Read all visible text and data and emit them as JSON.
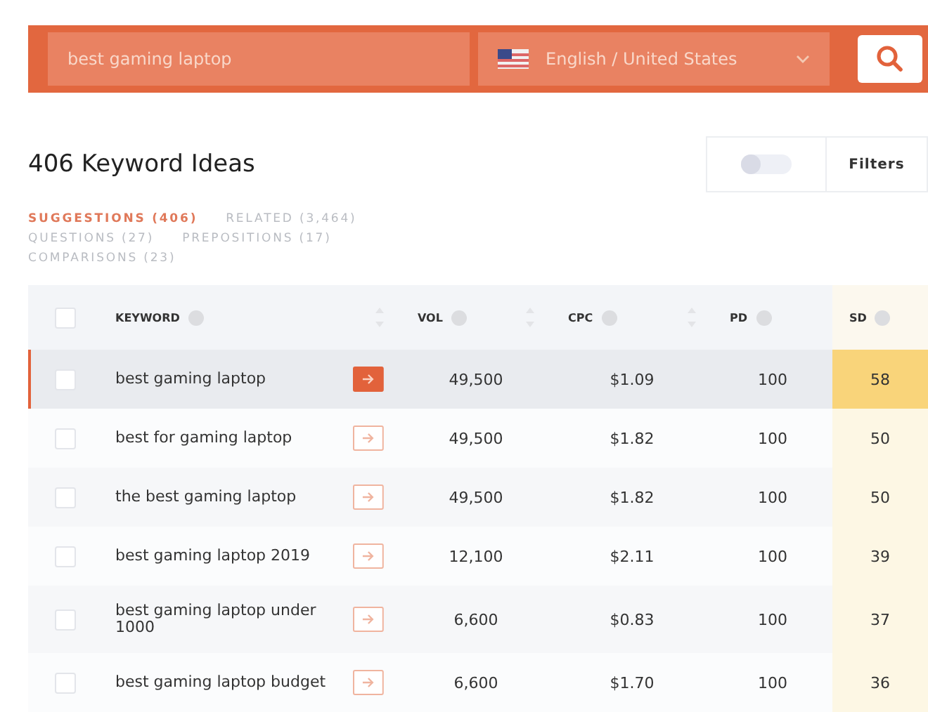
{
  "search": {
    "value": "best gaming laptop",
    "language": "English / United States"
  },
  "title": "406 Keyword Ideas",
  "filters": {
    "toggle_on": false,
    "label": "Filters"
  },
  "tabs": [
    {
      "label": "SUGGESTIONS (406)",
      "selected": true
    },
    {
      "label": "RELATED (3,464)",
      "selected": false
    },
    {
      "label": "QUESTIONS (27)",
      "selected": false
    },
    {
      "label": "PREPOSITIONS (17)",
      "selected": false
    },
    {
      "label": "COMPARISONS (23)",
      "selected": false
    }
  ],
  "table": {
    "select_all_checked": false,
    "columns": [
      {
        "label": "KEYWORD",
        "sortable": true
      },
      {
        "label": "VOL",
        "sortable": true
      },
      {
        "label": "CPC",
        "sortable": true
      },
      {
        "label": "PD",
        "sortable": false
      },
      {
        "label": "SD",
        "sortable": false
      }
    ],
    "rows": [
      {
        "keyword": "best gaming laptop",
        "vol": "49,500",
        "cpc": "$1.09",
        "pd": "100",
        "sd": "58",
        "selected": true,
        "checked": false
      },
      {
        "keyword": "best for gaming laptop",
        "vol": "49,500",
        "cpc": "$1.82",
        "pd": "100",
        "sd": "50",
        "selected": false,
        "checked": false
      },
      {
        "keyword": "the best gaming laptop",
        "vol": "49,500",
        "cpc": "$1.82",
        "pd": "100",
        "sd": "50",
        "selected": false,
        "checked": false
      },
      {
        "keyword": "best gaming laptop 2019",
        "vol": "12,100",
        "cpc": "$2.11",
        "pd": "100",
        "sd": "39",
        "selected": false,
        "checked": false
      },
      {
        "keyword": "best gaming laptop under 1000",
        "vol": "6,600",
        "cpc": "$0.83",
        "pd": "100",
        "sd": "37",
        "selected": false,
        "checked": false
      },
      {
        "keyword": "best gaming laptop budget",
        "vol": "6,600",
        "cpc": "$1.70",
        "pd": "100",
        "sd": "36",
        "selected": false,
        "checked": false
      }
    ]
  }
}
